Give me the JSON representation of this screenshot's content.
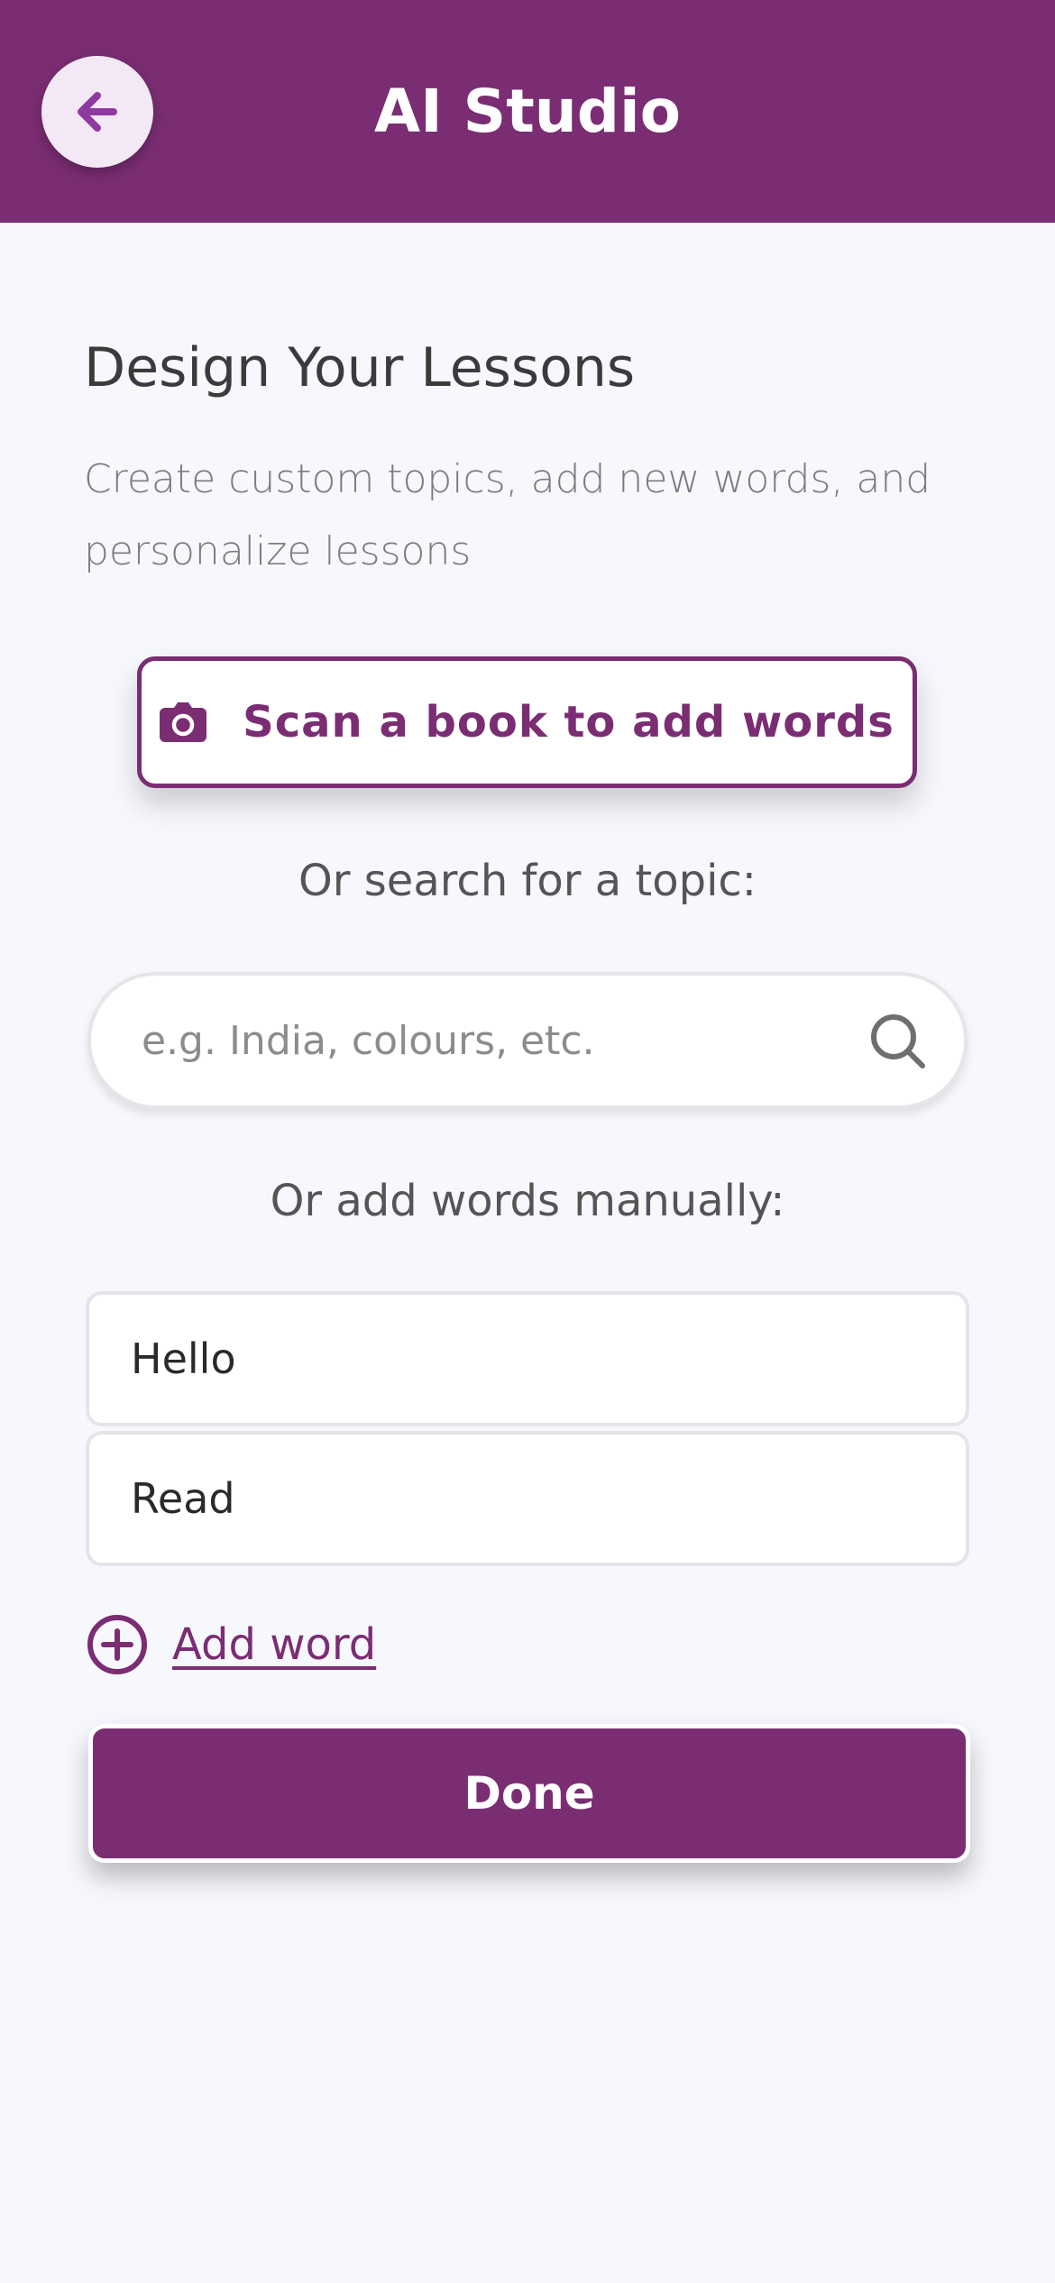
{
  "header": {
    "title": "AI Studio",
    "back_icon": "arrow-left-icon"
  },
  "main": {
    "heading": "Design Your Lessons",
    "subtitle": "Create custom topics, add new words, and personalize lessons",
    "scan_button": {
      "label": "Scan a book to add words",
      "icon": "camera-icon"
    },
    "search_prompt": "Or search for a topic:",
    "search": {
      "placeholder": "e.g. India, colours, etc.",
      "value": "",
      "icon": "search-icon"
    },
    "manual_prompt": "Or add words manually:",
    "words": [
      "Hello",
      "Read"
    ],
    "add_word": {
      "label": "Add word",
      "icon": "plus-circle-icon"
    },
    "done_button": {
      "label": "Done"
    }
  },
  "colors": {
    "brand": "#7b2d73",
    "background": "#f7f8fd",
    "back_button_bg": "#f3e8f5",
    "back_arrow": "#8e3aa0"
  }
}
